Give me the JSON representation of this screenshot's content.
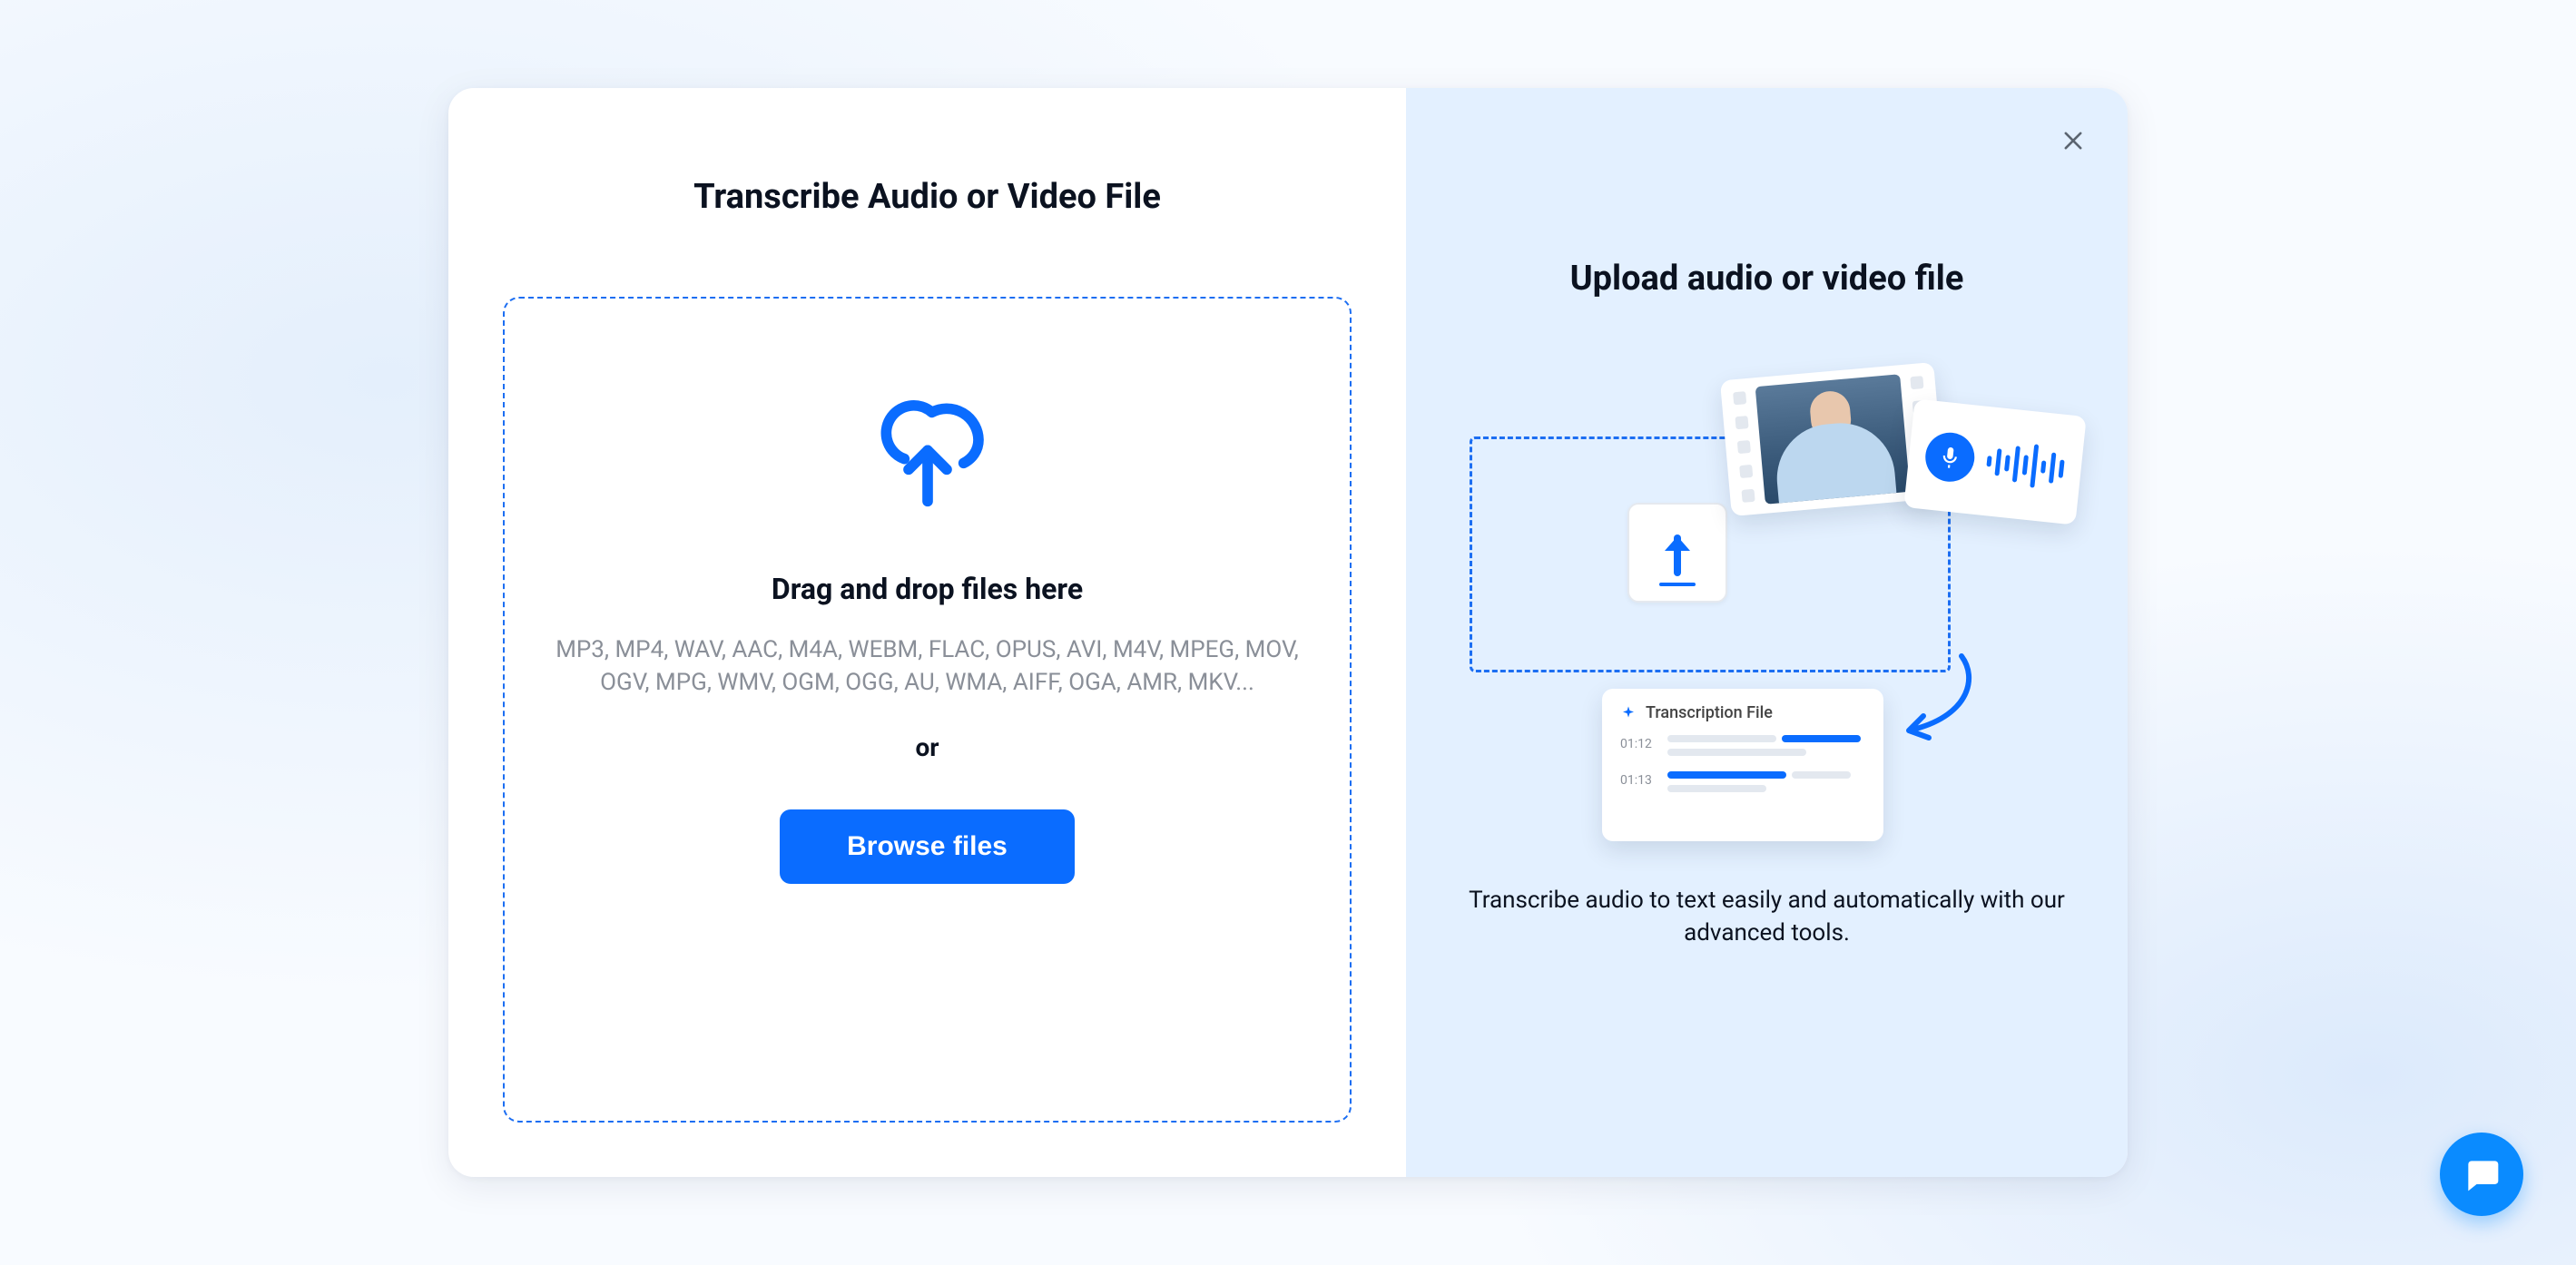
{
  "left": {
    "title": "Transcribe Audio or Video File",
    "dropzone": {
      "title": "Drag and drop files here",
      "formats": "MP3, MP4, WAV, AAC, M4A, WEBM, FLAC, OPUS, AVI, M4V, MPEG, MOV, OGV, MPG, WMV, OGM, OGG, AU, WMA, AIFF, OGA, AMR, MKV...",
      "or": "or",
      "browse": "Browse files"
    }
  },
  "right": {
    "title": "Upload audio or video file",
    "subtitle": "Transcribe audio to text easily and automatically with our advanced tools.",
    "illustration": {
      "transcription_card_title": "Transcription File",
      "timecodes": [
        "01:12",
        "01:13"
      ]
    }
  },
  "colors": {
    "accent": "#0a6cff",
    "panel_bg": "#e3f0ff"
  }
}
